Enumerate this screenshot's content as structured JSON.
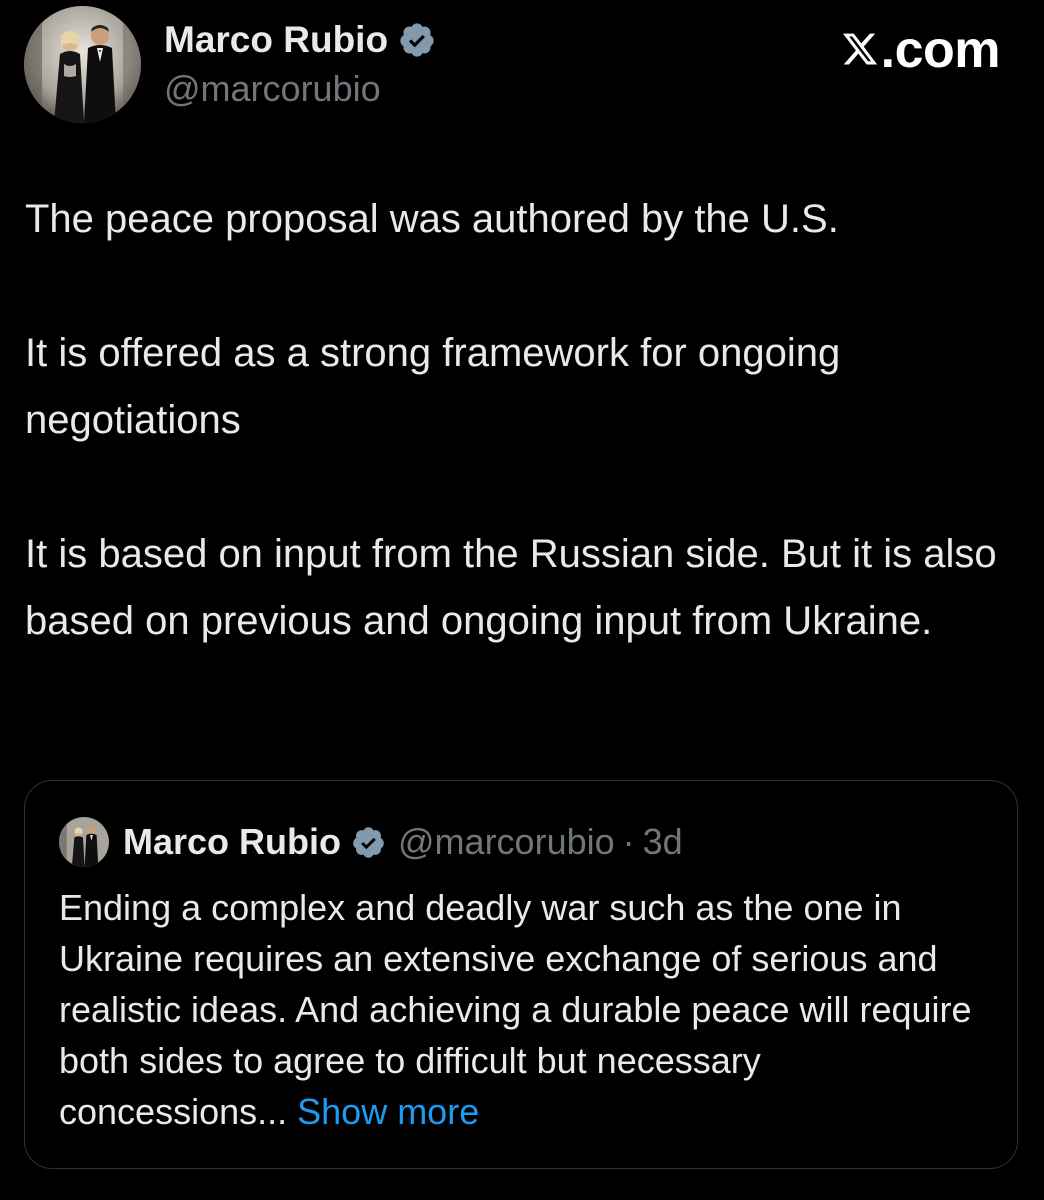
{
  "author": {
    "name": "Marco Rubio",
    "handle": "@marcorubio",
    "avatar_icon": "profile-photo",
    "verified_icon": "verified-badge-icon"
  },
  "site_logo": {
    "text": ".com",
    "icon": "x-logo-icon"
  },
  "tweet": {
    "paragraphs": [
      "The peace proposal was authored by the U.S.",
      "It is offered as a strong framework for ongoing negotiations",
      "It is based on input from the Russian side. But it is also based on previous and ongoing input from Ukraine."
    ]
  },
  "quote": {
    "name": "Marco Rubio",
    "handle": "@marcorubio",
    "separator": "·",
    "time": "3d",
    "text": "Ending a complex and deadly war such as the one in Ukraine requires an extensive exchange of serious and realistic ideas. And achieving a durable peace will require both sides to agree to difficult but necessary concessions...",
    "show_more": "Show more"
  },
  "colors": {
    "background": "#000000",
    "text": "#e7e9ea",
    "secondary_text": "#71767b",
    "link": "#1d9bf0",
    "verified_badge": "#829aab",
    "border": "#2f3336"
  }
}
